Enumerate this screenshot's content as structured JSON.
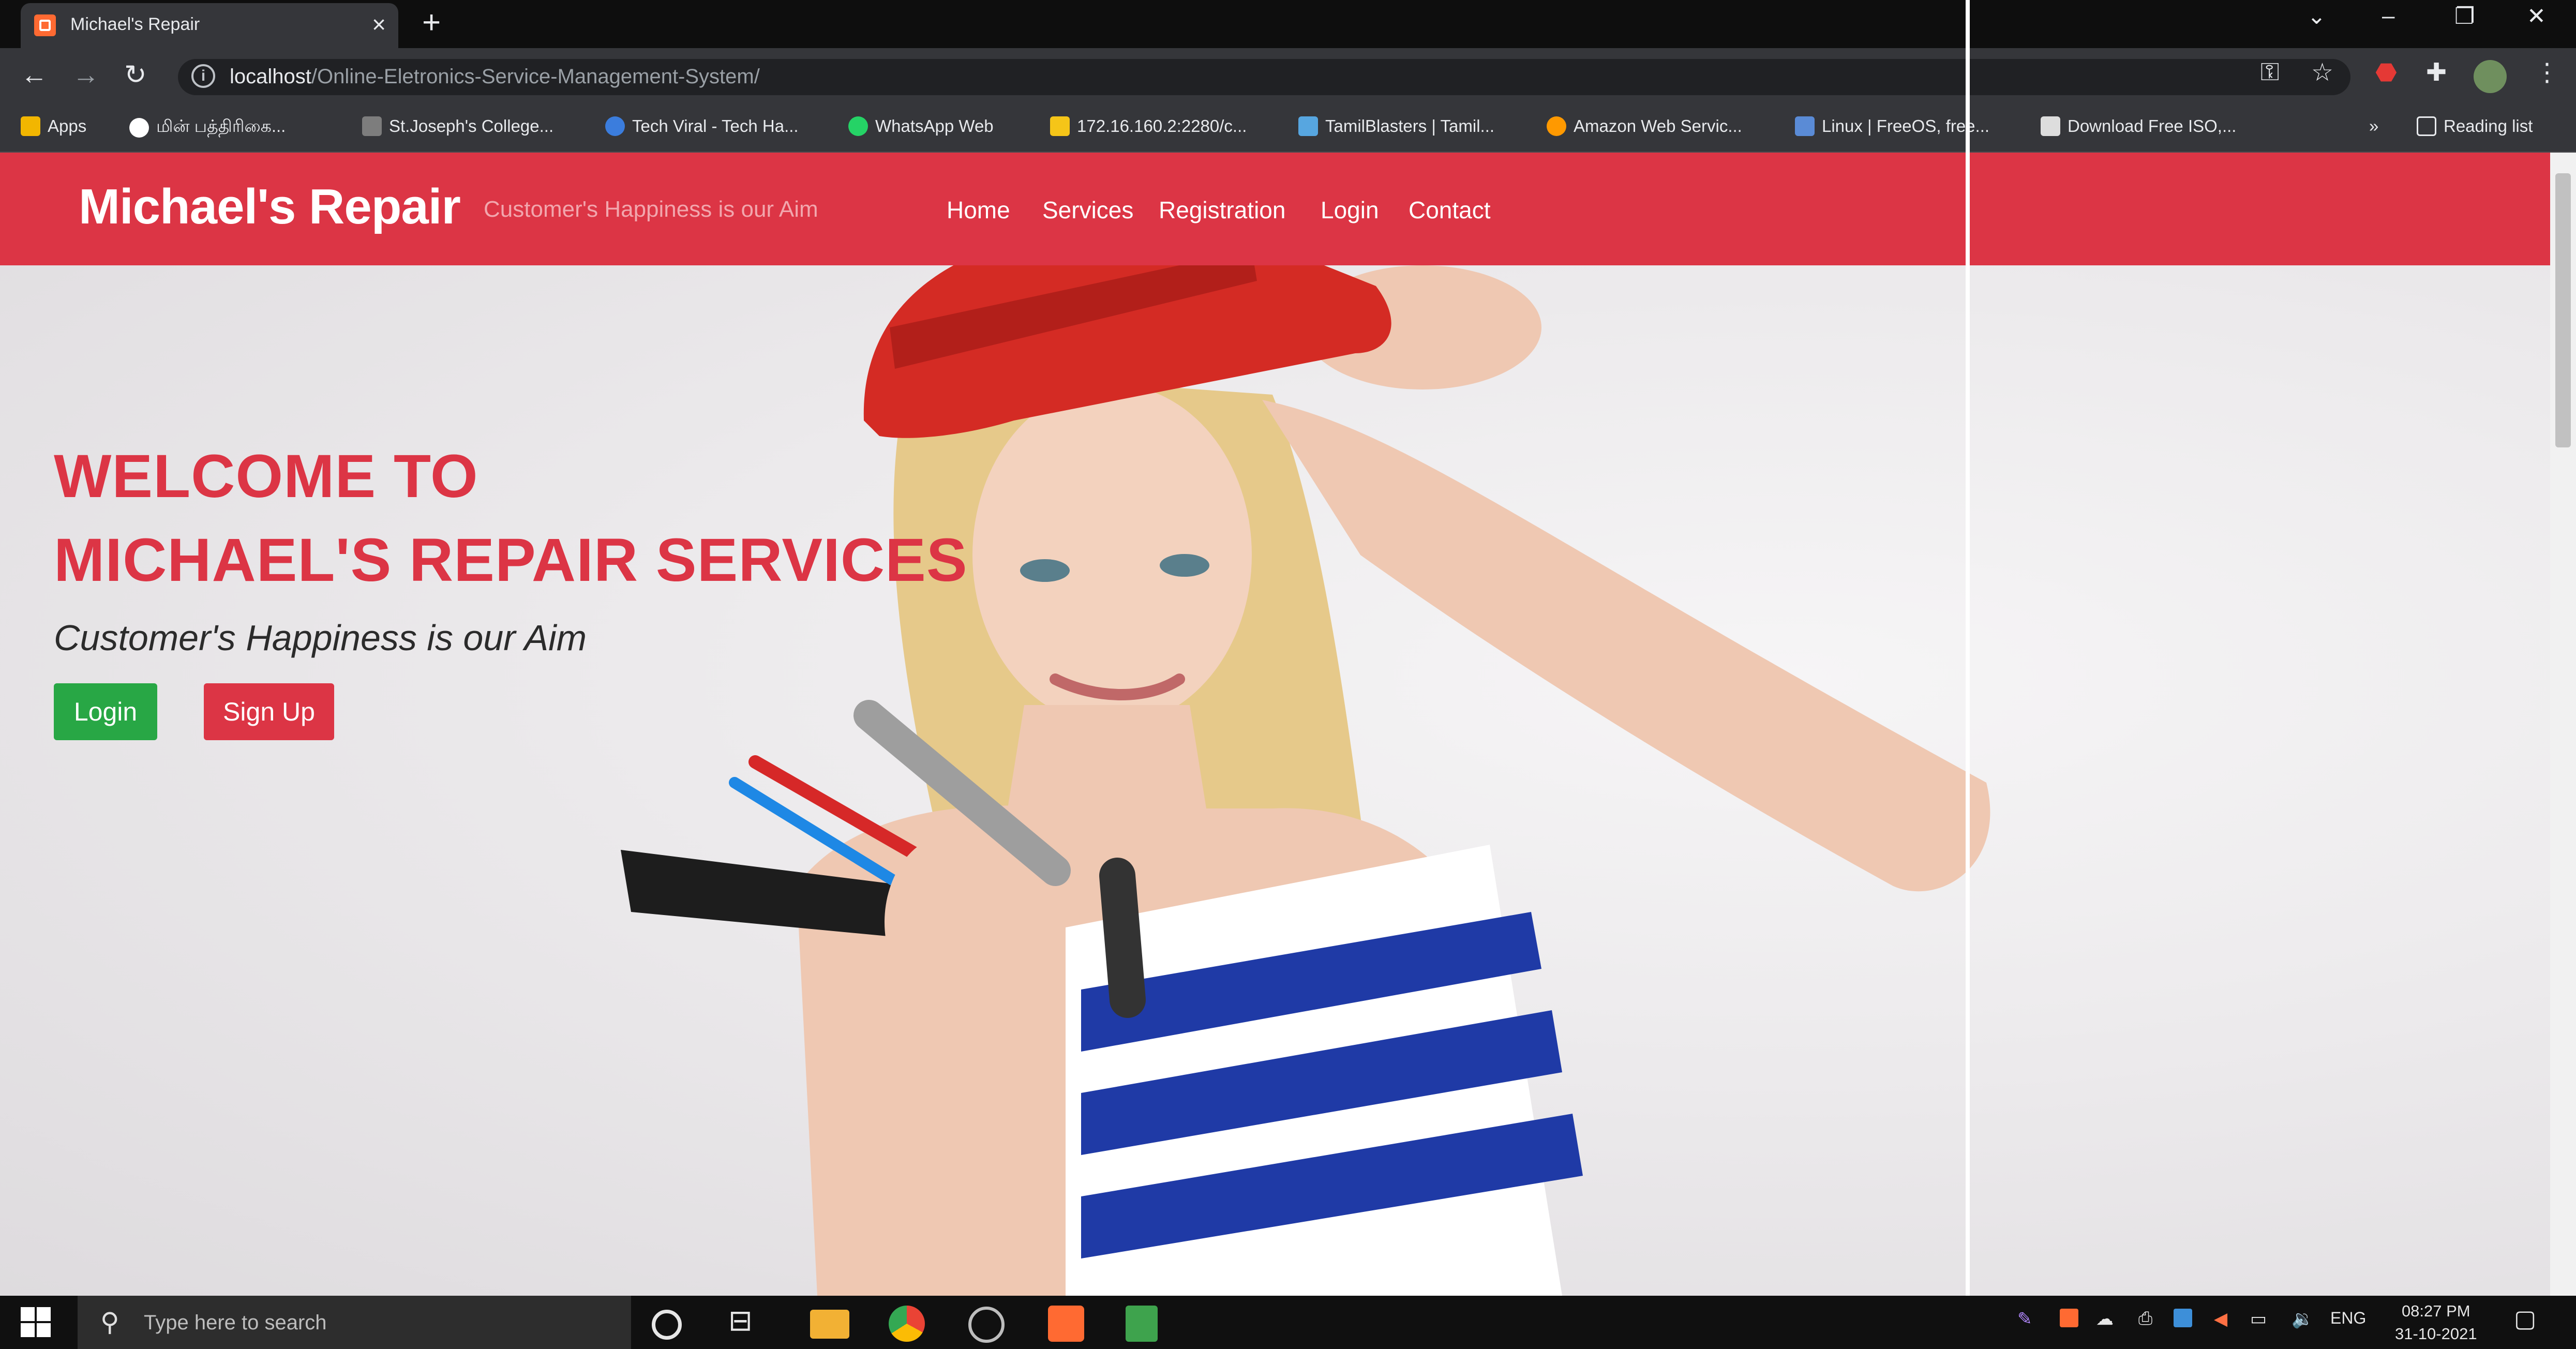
{
  "browser": {
    "tab_title": "Michael's Repair",
    "url_host": "localhost",
    "url_path": "/Online-Eletronics-Service-Management-System/",
    "bookmarks": [
      {
        "label": "Apps",
        "color": "#f2b600"
      },
      {
        "label": "மின் பத்திரிகை...",
        "color": "#ffffff"
      },
      {
        "label": "St.Joseph's College...",
        "color": "#7d7d7d"
      },
      {
        "label": "Tech Viral - Tech Ha...",
        "color": "#3b7ddd"
      },
      {
        "label": "WhatsApp Web",
        "color": "#25d366"
      },
      {
        "label": "172.16.160.2:2280/c...",
        "color": "#f5c518"
      },
      {
        "label": "TamilBlasters | Tamil...",
        "color": "#57a6e0"
      },
      {
        "label": "Amazon Web Servic...",
        "color": "#ff9900"
      },
      {
        "label": "Linux | FreeOS, free...",
        "color": "#5a8bd6"
      },
      {
        "label": "Download Free ISO,...",
        "color": "#dddddd"
      }
    ],
    "reading_list": "Reading list",
    "more_bookmarks": "»"
  },
  "site": {
    "brand": "Michael's Repair",
    "tagline": "Customer's Happiness is our Aim",
    "nav": [
      "Home",
      "Services",
      "Registration",
      "Login",
      "Contact"
    ],
    "hero": {
      "line1": "WELCOME TO",
      "line2": "MICHAEL'S REPAIR SERVICES",
      "tagline": "Customer's Happiness is our Aim",
      "login_label": "Login",
      "signup_label": "Sign Up"
    },
    "colors": {
      "primary": "#dc3545",
      "success": "#28a745"
    }
  },
  "taskbar": {
    "search_placeholder": "Type here to search",
    "language": "ENG",
    "time": "08:27 PM",
    "date": "31-10-2021"
  }
}
